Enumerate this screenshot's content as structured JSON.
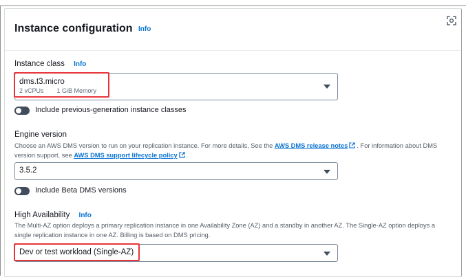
{
  "panel": {
    "title": "Instance configuration",
    "info": "Info"
  },
  "instance_class": {
    "label": "Instance class",
    "info": "Info",
    "value": "dms.t3.micro",
    "vcpus": "2 vCPUs",
    "memory": "1 GiB Memory",
    "toggle_label": "Include previous-generation instance classes"
  },
  "engine_version": {
    "label": "Engine version",
    "desc_part1": "Choose an AWS DMS version to run on your replication instance. For more details, See the ",
    "link1": "AWS DMS release notes",
    "desc_part2": ". For information about DMS version support, see ",
    "link2": "AWS DMS support lifecycle policy",
    "desc_part3": ".",
    "value": "3.5.2",
    "toggle_label": "Include Beta DMS versions"
  },
  "high_availability": {
    "label": "High Availability",
    "info": "Info",
    "desc": "The Multi-AZ option deploys a primary replication instance in one Availability Zone (AZ) and a standby in another AZ. The Single-AZ option deploys a single replication instance in one AZ. Billing is based on DMS pricing.",
    "value": "Dev or test workload (Single-AZ)"
  },
  "colors": {
    "link": "#0972d3",
    "highlight": "#e8353a",
    "toggle_off": "#414d5c"
  },
  "icons": [
    "expand-icon",
    "external-link-icon",
    "caret-down-icon"
  ]
}
